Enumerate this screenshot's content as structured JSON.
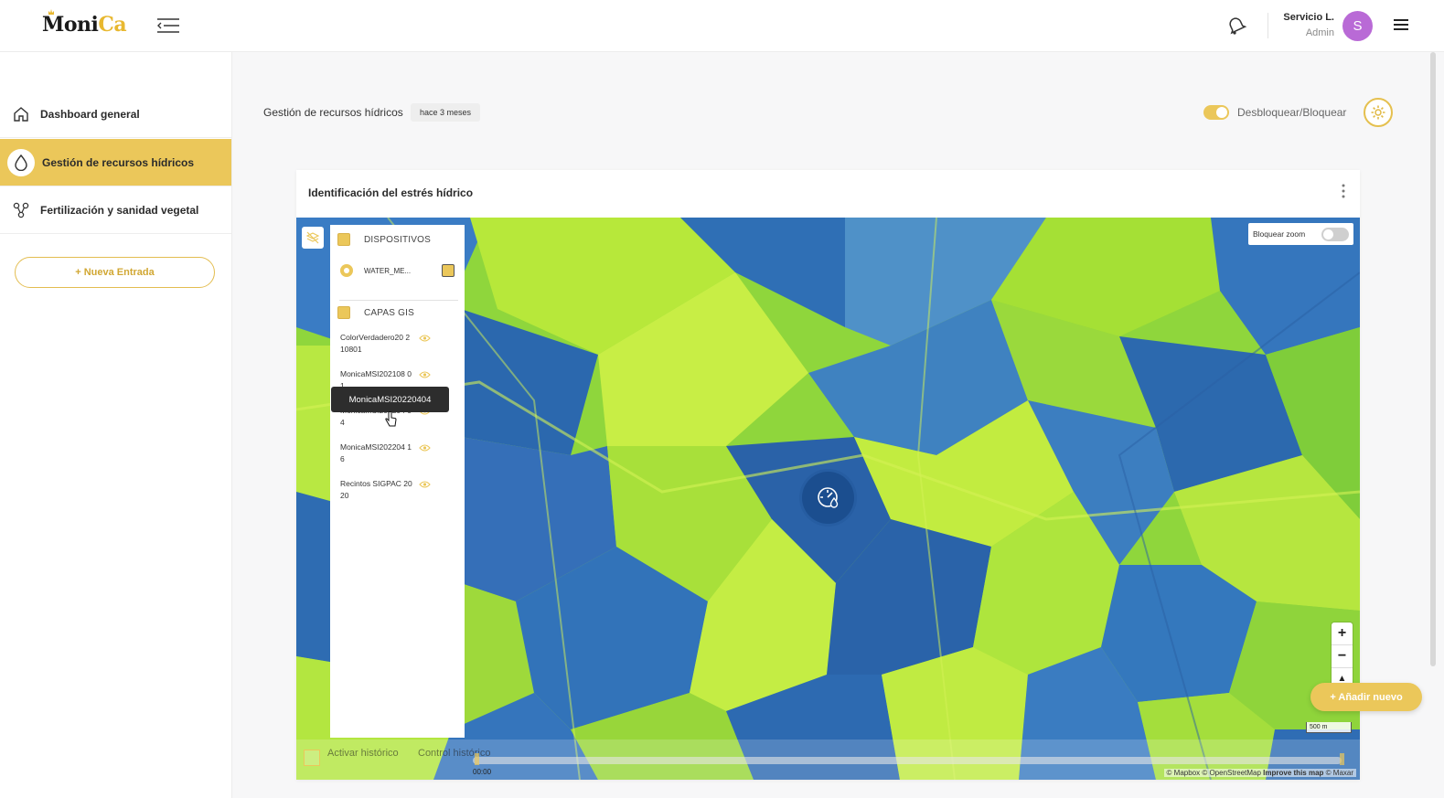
{
  "brand": {
    "logo_text_a": "Moni",
    "logo_text_b": "Ca",
    "accent": "#ebc75a"
  },
  "header": {
    "icons": [
      "collapse-menu-icon",
      "notifications-icon",
      "hamburger-menu-icon"
    ],
    "user_name": "Servicio L.",
    "user_role": "Admin",
    "avatar_initial": "S",
    "avatar_color": "#b96ad6"
  },
  "sidebar": {
    "items": [
      {
        "label": "Dashboard general",
        "icon": "home-icon",
        "active": false
      },
      {
        "label": "Gestión de recursos hídricos",
        "icon": "water-drop-icon",
        "active": true
      },
      {
        "label": "Fertilización y sanidad vegetal",
        "icon": "nodes-icon",
        "active": false
      }
    ],
    "new_entry_label": "+ Nueva Entrada"
  },
  "page": {
    "title": "Gestión de recursos hídricos",
    "time_badge": "hace 3 meses",
    "lock_label": "Desbloquear/Bloquear",
    "lock_on": true
  },
  "card": {
    "title": "Identificación del estrés hídrico",
    "map": {
      "layers_panel": {
        "devices_heading": "DISPOSITIVOS",
        "device_name": "WATER_ME...",
        "gis_heading": "CAPAS GIS",
        "layers": [
          {
            "label": "ColorVerdadero20 210801"
          },
          {
            "label": "MonicaMSI202108 01"
          },
          {
            "label": "MonicaMSI202204 04"
          },
          {
            "label": "MonicaMSI202204 16"
          },
          {
            "label": "Recintos SIGPAC 2020"
          }
        ]
      },
      "tooltip": "MonicaMSI20220404",
      "zoom_lock_label": "Bloquear zoom",
      "zoom_in": "+",
      "zoom_out": "−",
      "compass": "▲",
      "scale": "500 m",
      "history_activate": "Activar histórico",
      "history_control": "Control histórico",
      "timeline_start": "00:00",
      "attribution_a": "© Mapbox © OpenStreetMap",
      "attribution_b": "Improve this map",
      "attribution_c": "© Maxar"
    }
  },
  "add_new_label": "+ Añadir nuevo"
}
